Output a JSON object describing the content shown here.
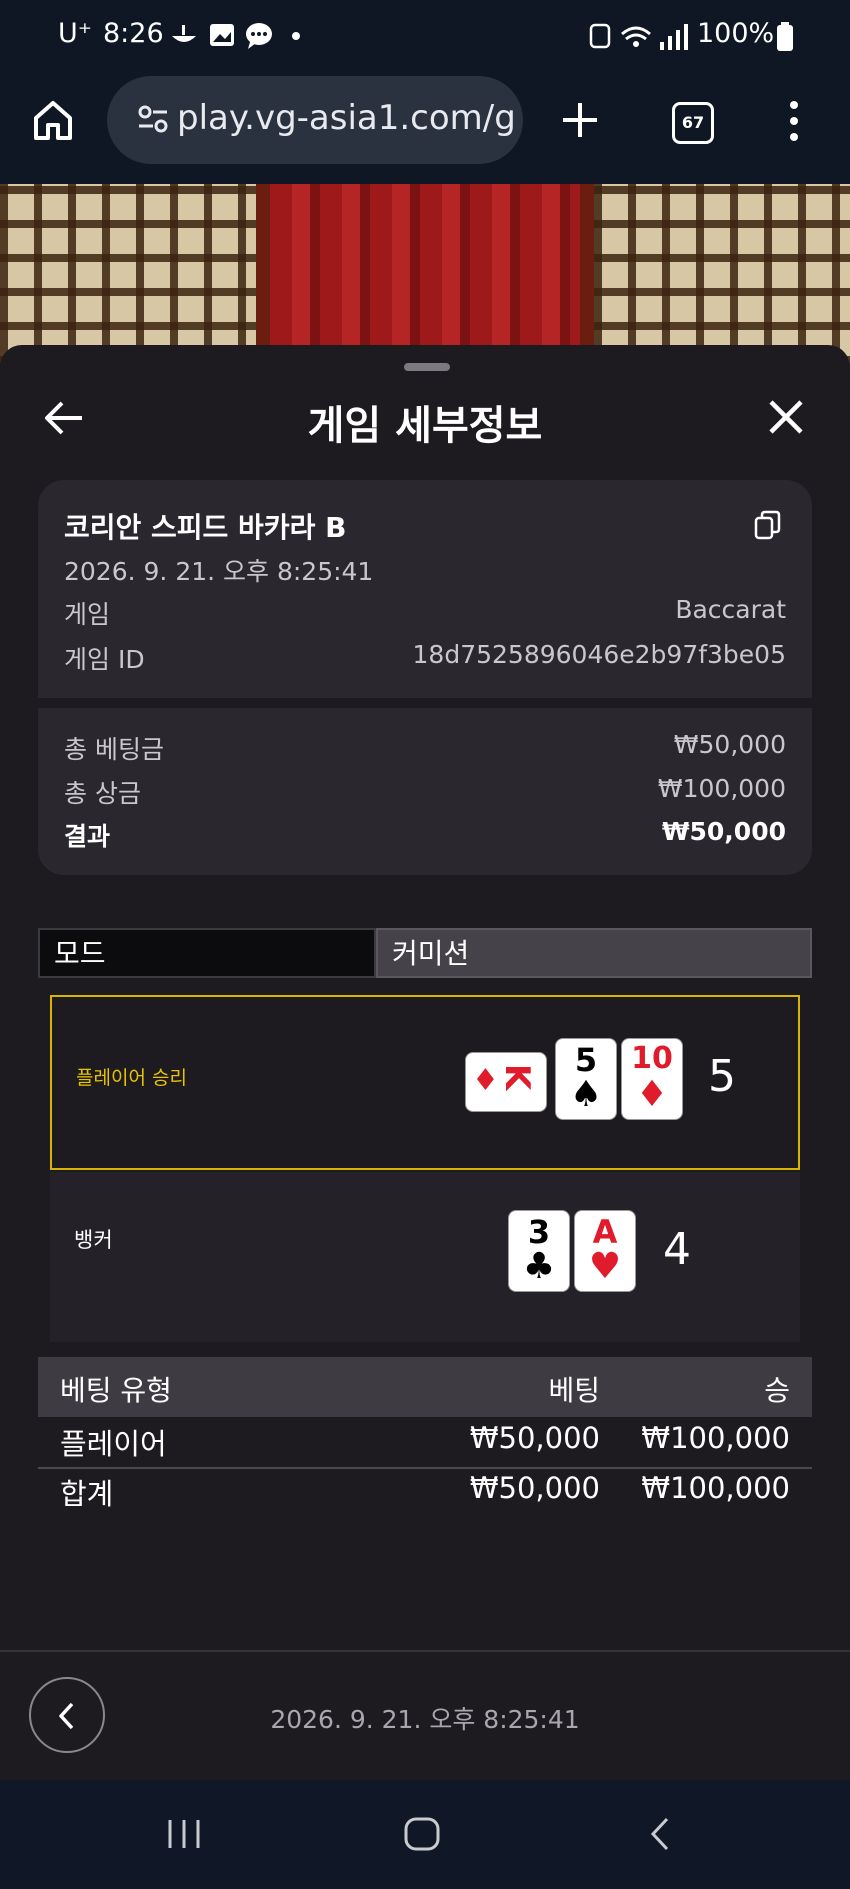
{
  "status_bar": {
    "carrier": "U⁺",
    "time": "8:26",
    "battery": "100%"
  },
  "browser": {
    "url": "play.vg-asia1.com/g",
    "tab_count": "67"
  },
  "sheet": {
    "title": "게임 세부정보"
  },
  "game_info": {
    "table_name": "코리안 스피드 바카라 B",
    "datetime": "2026. 9. 21. 오후 8:25:41",
    "game_label": "게임",
    "game_value": "Baccarat",
    "game_id_label": "게임 ID",
    "game_id_value": "18d7525896046e2b97f3be05"
  },
  "summary": {
    "total_bet_label": "총 베팅금",
    "total_bet_value": "₩50,000",
    "total_win_label": "총 상금",
    "total_win_value": "₩100,000",
    "result_label": "결과",
    "result_value": "₩50,000"
  },
  "tabs": {
    "mode_label": "모드",
    "commission_label": "커미션"
  },
  "player_hand": {
    "label": "플레이어 승리",
    "cards": [
      {
        "rank": "K",
        "suit": "♦"
      },
      {
        "rank": "5",
        "suit": "♠"
      },
      {
        "rank": "10",
        "suit": "♦"
      }
    ],
    "total": "5"
  },
  "banker_hand": {
    "label": "뱅커",
    "cards": [
      {
        "rank": "3",
        "suit": "♣"
      },
      {
        "rank": "A",
        "suit": "♥"
      }
    ],
    "total": "4"
  },
  "bet_table": {
    "headers": [
      "베팅 유형",
      "베팅",
      "승"
    ],
    "rows": [
      {
        "type": "플레이어",
        "bet": "₩50,000",
        "win": "₩100,000"
      }
    ],
    "total": {
      "type": "합계",
      "bet": "₩50,000",
      "win": "₩100,000"
    }
  },
  "footer": {
    "datetime": "2026. 9. 21. 오후 8:25:41"
  },
  "colors": {
    "accent_yellow": "#d8b600",
    "card_red": "#e01b2b",
    "sheet_bg": "#1d1b20"
  }
}
